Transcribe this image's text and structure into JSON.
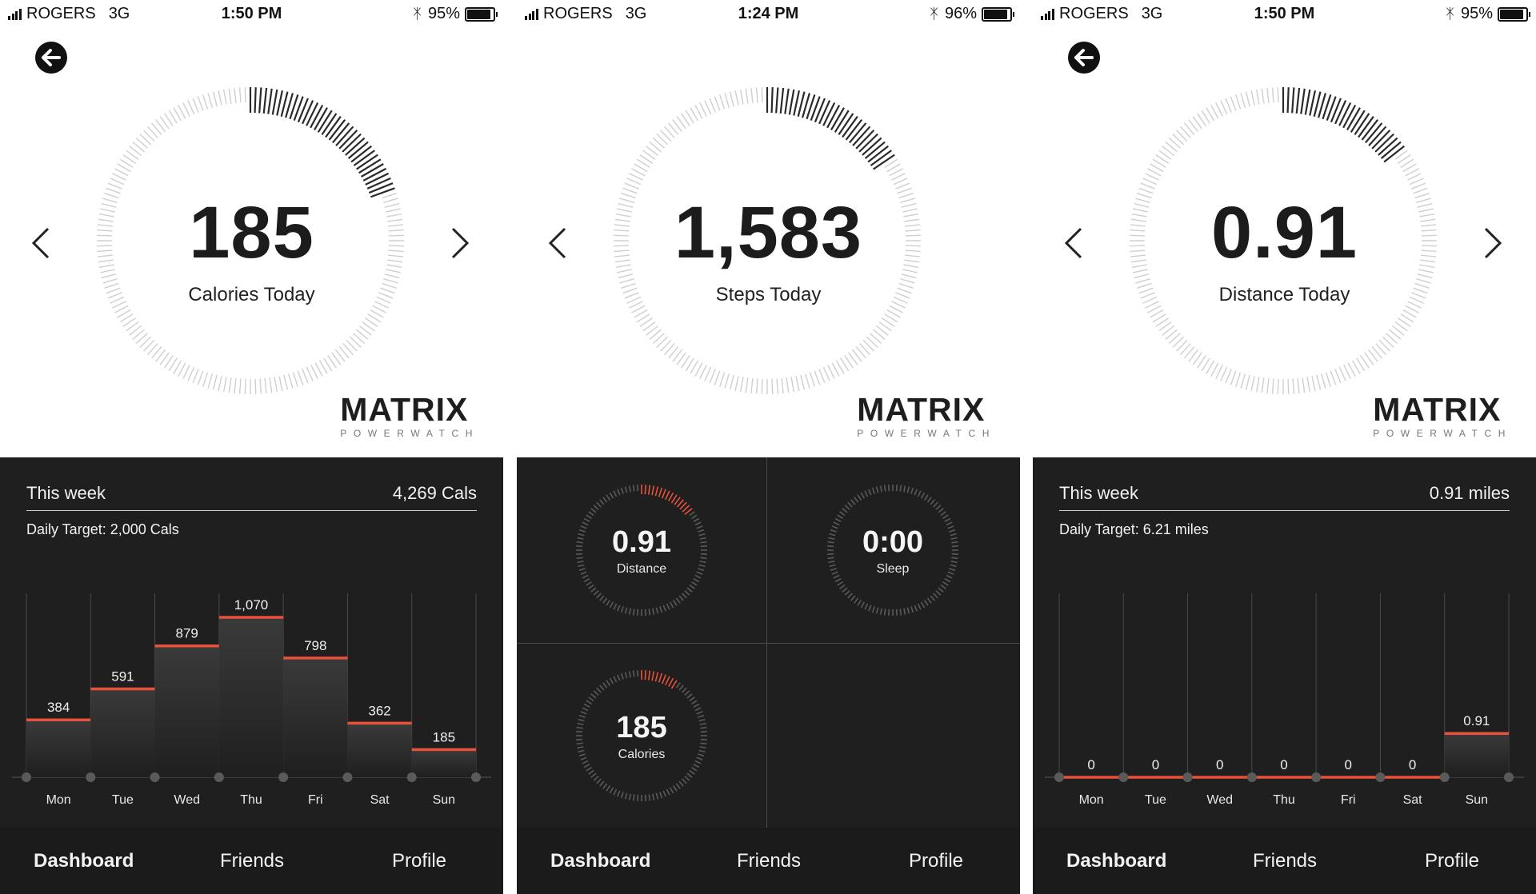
{
  "screens": [
    {
      "status": {
        "carrier": "ROGERS",
        "network": "3G",
        "time": "1:50 PM",
        "battery": "95%",
        "battery_level": 0.95
      },
      "has_back": true,
      "hero": {
        "value": "185",
        "label": "Calories Today",
        "progress": 0.2
      },
      "brand": {
        "name": "MATRIX",
        "sub": "POWERWATCH"
      },
      "week": {
        "label": "This week",
        "total": "4,269 Cals",
        "target": "Daily Target: 2,000 Cals"
      },
      "chart_data": {
        "type": "bar",
        "categories": [
          "Mon",
          "Tue",
          "Wed",
          "Thu",
          "Fri",
          "Sat",
          "Sun"
        ],
        "values": [
          384,
          591,
          879,
          1070,
          798,
          362,
          185
        ],
        "value_labels": [
          "384",
          "591",
          "879",
          "1,070",
          "798",
          "362",
          "185"
        ],
        "ylim": [
          0,
          2000
        ],
        "bar_color": "#e8513a"
      }
    },
    {
      "status": {
        "carrier": "ROGERS",
        "network": "3G",
        "time": "1:24 PM",
        "battery": "96%",
        "battery_level": 0.96
      },
      "has_back": false,
      "hero": {
        "value": "1,583",
        "label": "Steps Today",
        "progress": 0.16
      },
      "brand": {
        "name": "MATRIX",
        "sub": "POWERWATCH"
      },
      "tiles": [
        {
          "value": "0.91",
          "label": "Distance",
          "progress": 0.15
        },
        {
          "value": "0:00",
          "label": "Sleep",
          "progress": 0
        },
        {
          "value": "185",
          "label": "Calories",
          "progress": 0.1
        }
      ]
    },
    {
      "status": {
        "carrier": "ROGERS",
        "network": "3G",
        "time": "1:50 PM",
        "battery": "95%",
        "battery_level": 0.95
      },
      "has_back": true,
      "hero": {
        "value": "0.91",
        "label": "Distance Today",
        "progress": 0.15
      },
      "brand": {
        "name": "MATRIX",
        "sub": "POWERWATCH"
      },
      "week": {
        "label": "This week",
        "total": "0.91 miles",
        "target": "Daily Target: 6.21 miles"
      },
      "chart_data": {
        "type": "bar",
        "categories": [
          "Mon",
          "Tue",
          "Wed",
          "Thu",
          "Fri",
          "Sat",
          "Sun"
        ],
        "values": [
          0,
          0,
          0,
          0,
          0,
          0,
          0.91
        ],
        "value_labels": [
          "0",
          "0",
          "0",
          "0",
          "0",
          "0",
          "0.91"
        ],
        "ylim": [
          0,
          6.21
        ],
        "bar_color": "#e8513a"
      }
    }
  ],
  "tabs": {
    "dashboard": "Dashboard",
    "friends": "Friends",
    "profile": "Profile"
  },
  "colors": {
    "accent": "#e8513a",
    "panel": "#1f1f1f",
    "ink": "#1c1c1c"
  },
  "icons": {
    "back": "back-arrow-circle-icon",
    "prev": "chevron-left-icon",
    "next": "chevron-right-icon",
    "bluetooth": "bluetooth-icon",
    "battery": "battery-icon",
    "signal": "signal-bars-icon"
  }
}
